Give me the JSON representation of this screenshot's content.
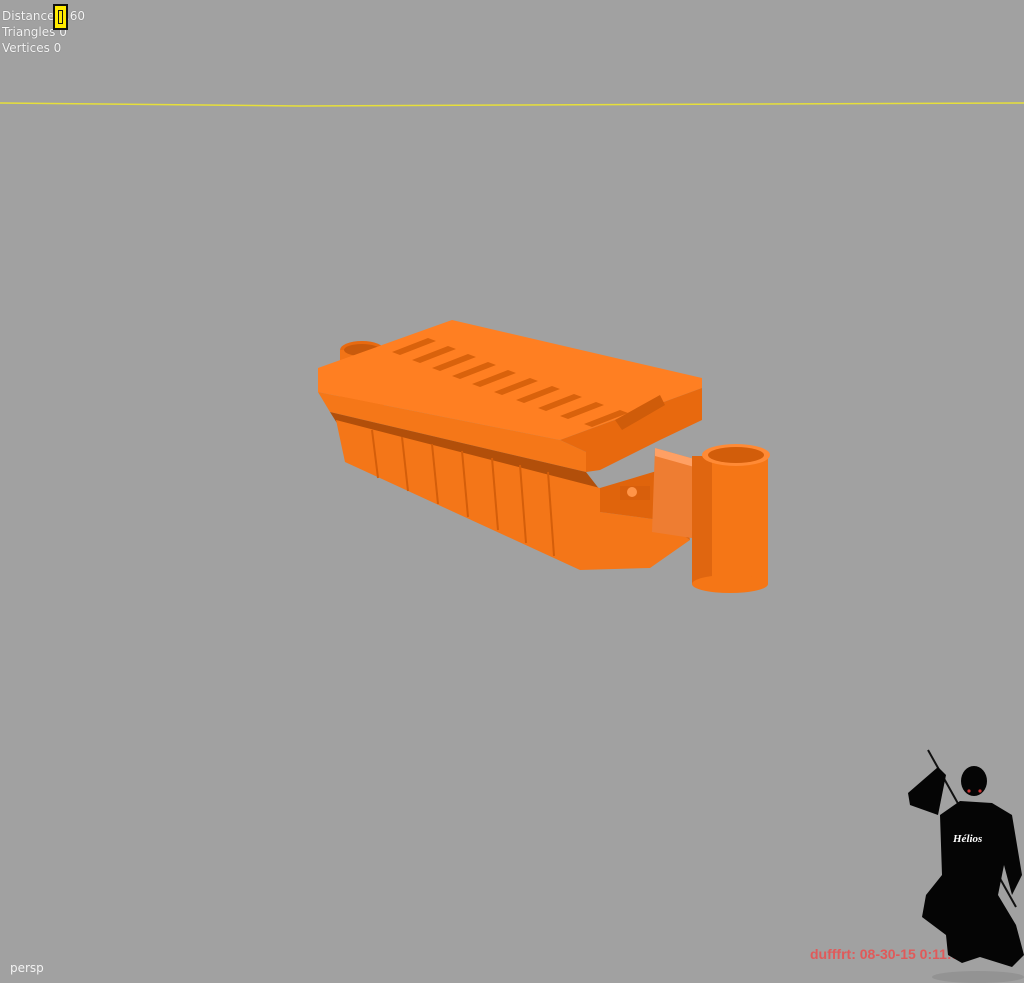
{
  "viewport": {
    "background": "#a1a1a1",
    "camera": "persp",
    "horizon_color": "#e6df3a",
    "model_color": "#ff7a1a"
  },
  "hud": {
    "distance": "Distance 2.60",
    "triangles": "Triangles 0",
    "vertices": "Vertices 0"
  },
  "watermark": {
    "caption": "dufffrt: 08-30-15 0:11:51",
    "logo_text": "Hélios"
  }
}
